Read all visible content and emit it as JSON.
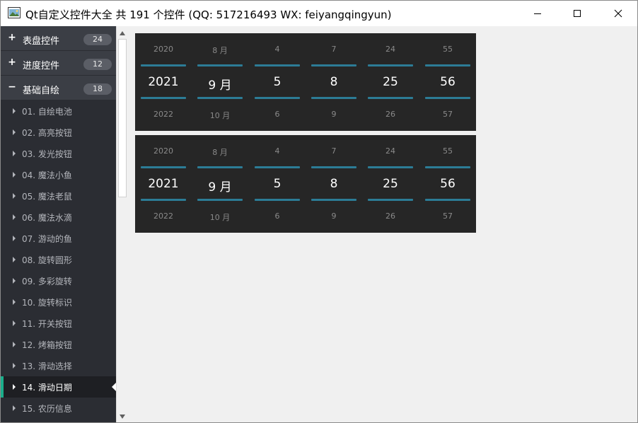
{
  "window": {
    "title": "Qt自定义控件大全 共 191 个控件 (QQ: 517216493 WX: feiyangqingyun)"
  },
  "sidebar": {
    "groups": [
      {
        "sign": "+",
        "label": "表盘控件",
        "count": "24"
      },
      {
        "sign": "+",
        "label": "进度控件",
        "count": "12"
      },
      {
        "sign": "−",
        "label": "基础自绘",
        "count": "18"
      }
    ],
    "items": [
      {
        "label": "01. 自绘电池"
      },
      {
        "label": "02. 高亮按钮"
      },
      {
        "label": "03. 发光按钮"
      },
      {
        "label": "04. 魔法小鱼"
      },
      {
        "label": "05. 魔法老鼠"
      },
      {
        "label": "06. 魔法水滴"
      },
      {
        "label": "07. 游动的鱼"
      },
      {
        "label": "08. 旋转圆形"
      },
      {
        "label": "09. 多彩旋转"
      },
      {
        "label": "10. 旋转标识"
      },
      {
        "label": "11. 开关按钮"
      },
      {
        "label": "12. 烤箱按钮"
      },
      {
        "label": "13. 滑动选择"
      },
      {
        "label": "14. 滑动日期"
      },
      {
        "label": "15. 农历信息"
      }
    ],
    "active_index": 13,
    "accent_color": "#1bae8b"
  },
  "pickers": [
    {
      "columns": [
        {
          "prev": "2020",
          "current": "2021",
          "next": "2022"
        },
        {
          "prev": "8 月",
          "current": "9 月",
          "next": "10 月"
        },
        {
          "prev": "4",
          "current": "5",
          "next": "6"
        },
        {
          "prev": "7",
          "current": "8",
          "next": "9"
        },
        {
          "prev": "24",
          "current": "25",
          "next": "26"
        },
        {
          "prev": "55",
          "current": "56",
          "next": "57"
        }
      ]
    },
    {
      "columns": [
        {
          "prev": "2020",
          "current": "2021",
          "next": "2022"
        },
        {
          "prev": "8 月",
          "current": "9 月",
          "next": "10 月"
        },
        {
          "prev": "4",
          "current": "5",
          "next": "6"
        },
        {
          "prev": "7",
          "current": "8",
          "next": "9"
        },
        {
          "prev": "24",
          "current": "25",
          "next": "26"
        },
        {
          "prev": "55",
          "current": "56",
          "next": "57"
        }
      ]
    }
  ],
  "colors": {
    "picker_background": "#262626",
    "picker_line": "#2c7c96",
    "sidebar_background": "#2b2d33"
  }
}
